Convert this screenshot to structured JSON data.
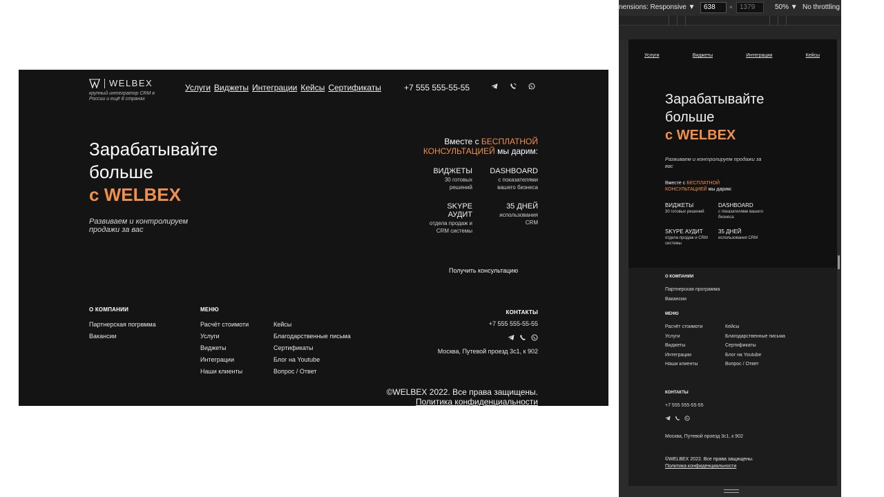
{
  "brand": {
    "logo_word": "WELBEX",
    "tagline": "крупный интегратор CRM в России и ещё 8 странах",
    "accent_color": "#f2904a"
  },
  "nav": {
    "items": [
      "Услуги",
      "Виджеты",
      "Интеграции",
      "Кейсы",
      "Сертификаты"
    ],
    "phone": "+7 555 555-55-55",
    "icons": [
      "telegram-icon",
      "viber-icon",
      "whatsapp-icon"
    ]
  },
  "hero": {
    "line1": "Зарабатывайте",
    "line2": "больше",
    "prefix": "с",
    "brand": "WELBEX",
    "subtitle": "Развиваем и контролируем продажи за вас"
  },
  "gift": {
    "lead": "Вместе с",
    "highlight_1": "БЕСПЛАТНОЙ",
    "highlight_2": "КОНСУЛЬТАЦИЕЙ",
    "tail": "мы дарим:",
    "items": [
      {
        "title": "ВИДЖЕТЫ",
        "desc": "30 готовых решений"
      },
      {
        "title": "DASHBOARD",
        "desc": "с показателями вашего бизнеса"
      },
      {
        "title": "SKYPE АУДИТ",
        "desc": "отдела продаж и CRM системы"
      },
      {
        "title": "35 ДНЕЙ",
        "desc": "использования CRM"
      }
    ],
    "cta": "Получить консультацию"
  },
  "footer": {
    "company_title": "О КОМПАНИИ",
    "company_items": [
      "Партнерская погрвмма",
      "Вакансии"
    ],
    "company_items_mobile": [
      "Партнерская программа",
      "Вакансии"
    ],
    "menu_title": "МЕНЮ",
    "menu_col1": [
      "Расчёт стоимоти",
      "Услуги",
      "Виджеты",
      "Интеграции",
      "Наши клиенты"
    ],
    "menu_col2": [
      "Кейсы",
      "Благодарственные письма",
      "Сертификаты",
      "Блог на Youtube",
      "Вопрос / Ответ"
    ],
    "contacts_title": "КОНТАКТЫ",
    "phone": "+7 555 555-55-55",
    "address": "Москва, Путевой проезд 3с1, к 902",
    "copyright": "©WELBEX 2022. Все права защищены.",
    "privacy": "Политика конфиденциальности"
  },
  "devtools": {
    "dimensions_label": "nensions: Responsive ▼",
    "width_value": "638",
    "times": "×",
    "height_value": "1379",
    "zoom": "50% ▼",
    "throttling": "No throttling"
  }
}
